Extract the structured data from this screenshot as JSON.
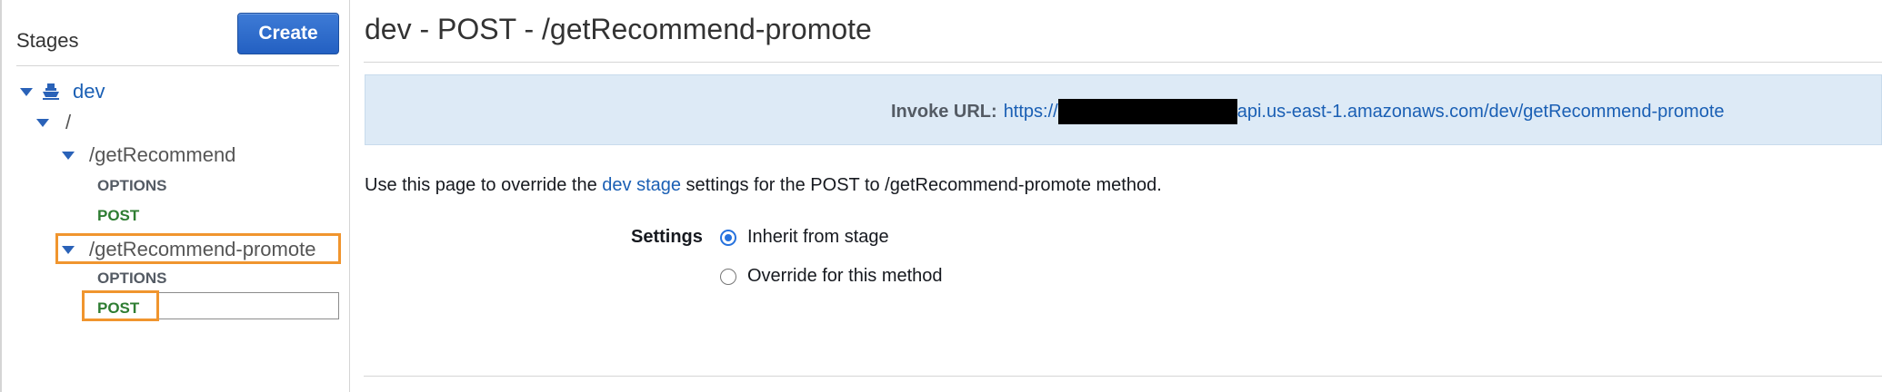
{
  "sidebar": {
    "title": "Stages",
    "create_label": "Create",
    "tree": {
      "stage": "dev",
      "root": "/",
      "resources": [
        {
          "path": "/getRecommend",
          "methods": [
            "OPTIONS",
            "POST"
          ]
        },
        {
          "path": "/getRecommend-promote",
          "methods": [
            "OPTIONS",
            "POST"
          ]
        }
      ]
    }
  },
  "main": {
    "title": "dev - POST - /getRecommend-promote",
    "invoke": {
      "label": "Invoke URL:",
      "url_prefix": "https://",
      "url_suffix": "api.us-east-1.amazonaws.com/dev/getRecommend-promote"
    },
    "description": {
      "before": "Use this page to override the ",
      "link": "dev stage",
      "after": " settings for the POST to /getRecommend-promote method."
    },
    "settings": {
      "label": "Settings",
      "options": [
        {
          "label": "Inherit from stage",
          "selected": true
        },
        {
          "label": "Override for this method",
          "selected": false
        }
      ]
    }
  },
  "colors": {
    "accent": "#2672de",
    "link": "#1a5fb4",
    "post_method": "#2e7d32",
    "highlight": "#f0952e",
    "invoke_bg": "#ddeaf6"
  }
}
